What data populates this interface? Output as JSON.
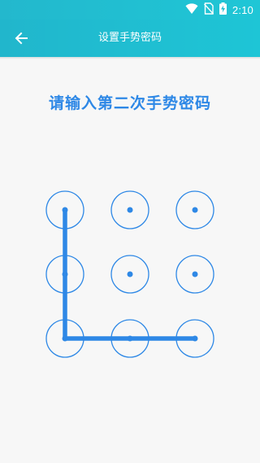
{
  "status_bar": {
    "time": "2:10",
    "icons": [
      "wifi-icon",
      "no-sim-icon",
      "battery-charging-icon"
    ]
  },
  "app_bar": {
    "back_icon": "back-arrow-icon",
    "title": "设置手势密码"
  },
  "main": {
    "prompt": "请输入第二次手势密码"
  },
  "pattern": {
    "grid": [
      3,
      3
    ],
    "selected_sequence": [
      1,
      4,
      7,
      8,
      9
    ]
  },
  "colors": {
    "accent": "#2e88e6",
    "toolbar": "#21bcd0",
    "background": "#f7f7f7"
  }
}
